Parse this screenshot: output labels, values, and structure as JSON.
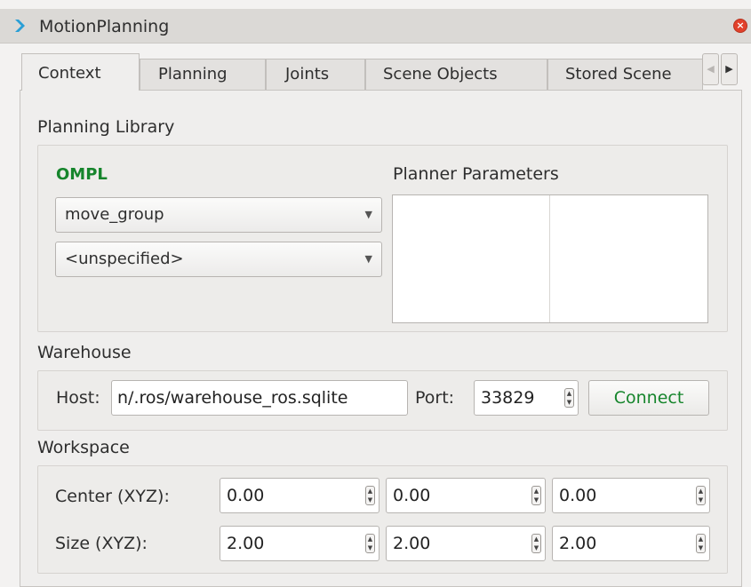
{
  "window": {
    "title": "MotionPlanning"
  },
  "tabs": [
    {
      "label": "Context",
      "active": true
    },
    {
      "label": "Planning",
      "active": false
    },
    {
      "label": "Joints",
      "active": false
    },
    {
      "label": "Scene Objects",
      "active": false
    },
    {
      "label": "Stored Scene",
      "active": false
    }
  ],
  "planning_library": {
    "section_label": "Planning Library",
    "library_name": "OMPL",
    "library_color": "#16852c",
    "group_select": "move_group",
    "planner_select": "<unspecified>",
    "params_title": "Planner Parameters"
  },
  "warehouse": {
    "section_label": "Warehouse",
    "host_label": "Host:",
    "host_value": "n/.ros/warehouse_ros.sqlite",
    "port_label": "Port:",
    "port_value": "33829",
    "connect_label": "Connect"
  },
  "workspace": {
    "section_label": "Workspace",
    "center_label": "Center (XYZ):",
    "center": [
      "0.00",
      "0.00",
      "0.00"
    ],
    "size_label": "Size (XYZ):",
    "size": [
      "2.00",
      "2.00",
      "2.00"
    ]
  },
  "icons": {
    "app": "rviz-chevron-icon",
    "close": "close-icon",
    "tab_left": "arrow-left-icon",
    "tab_right": "arrow-right-icon",
    "combo": "chevron-down-icon",
    "spin": "spin-arrows-icon"
  }
}
